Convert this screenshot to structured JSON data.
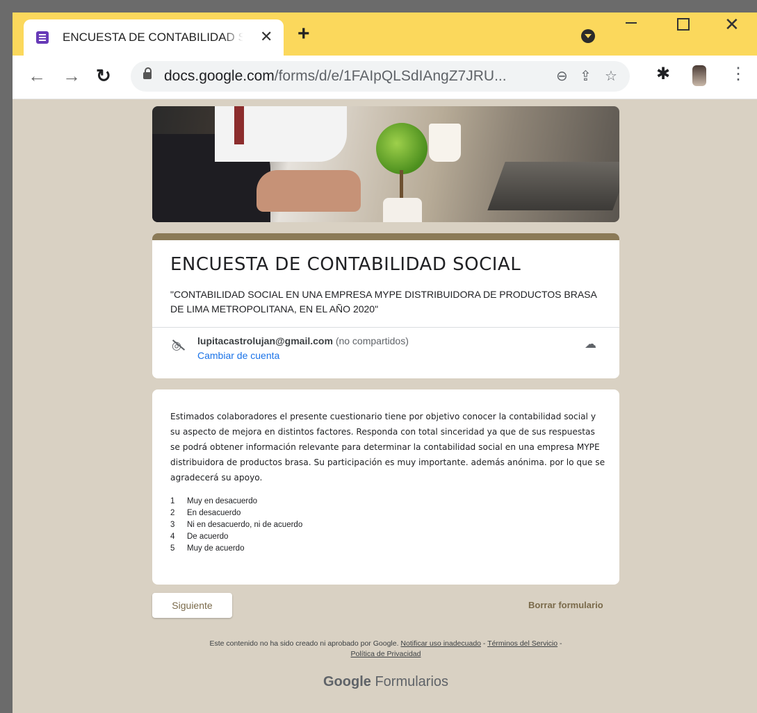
{
  "browser": {
    "tab_title": "ENCUESTA DE CONTABILIDAD SOCIAL",
    "url_host": "docs.google.com",
    "url_path": "/forms/d/e/1FAIpQLSdIAngZ7JRU..."
  },
  "form": {
    "title": "ENCUESTA DE CONTABILIDAD SOCIAL",
    "description": "\"CONTABILIDAD SOCIAL EN UNA EMPRESA MYPE DISTRIBUIDORA DE PRODUCTOS BRASA DE LIMA METROPOLITANA, EN EL AÑO 2020\"",
    "account_email": "lupitacastrolujan@gmail.com",
    "account_note": "(no compartidos)",
    "switch_account": "Cambiar de cuenta",
    "intro": "Estimados colaboradores el presente cuestionario tiene por objetivo conocer la contabilidad social y su aspecto de mejora en distintos factores. Responda con total sinceridad ya que de sus respuestas se podrá obtener información relevante para determinar la contabilidad social en una empresa MYPE distribuidora de productos brasa. Su participación es muy importante. además anónima. por lo que se agradecerá su apoyo.",
    "scale": [
      {
        "n": "1",
        "label": "Muy en desacuerdo"
      },
      {
        "n": "2",
        "label": "En desacuerdo"
      },
      {
        "n": "3",
        "label": "Ni en desacuerdo, ni de acuerdo"
      },
      {
        "n": "4",
        "label": "De acuerdo"
      },
      {
        "n": "5",
        "label": "Muy de acuerdo"
      }
    ],
    "next_button": "Siguiente",
    "clear_button": "Borrar formulario"
  },
  "footer": {
    "disclaimer": "Este contenido no ha sido creado ni aprobado por Google.",
    "report_link": "Notificar uso inadecuado",
    "terms_link": "Términos del Servicio",
    "privacy_link": "Política de Privacidad",
    "brand_google": "Google",
    "brand_product": "Formularios"
  },
  "colors": {
    "tab_strip": "#fbd85c",
    "page_background": "#d9d1c3",
    "form_accent": "#8b7a57"
  }
}
